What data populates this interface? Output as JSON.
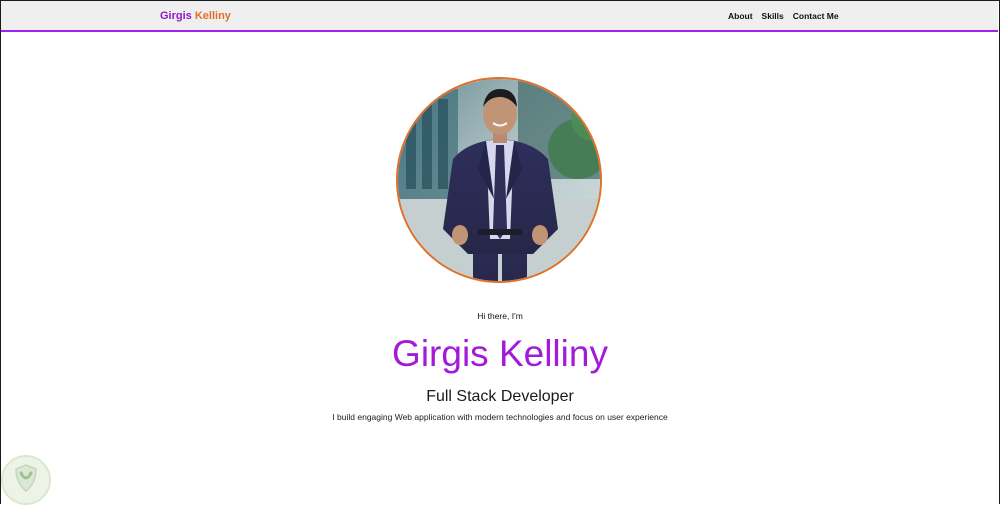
{
  "nav": {
    "brand_first": "Girgis",
    "brand_last": "Kelliny",
    "links": [
      "About",
      "Skills",
      "Contact Me"
    ]
  },
  "hero": {
    "greeting": "Hi there, I'm",
    "name": "Girgis Kelliny",
    "role": "Full Stack Developer",
    "description": "I build engaging Web application with modern technologies and focus on user experience"
  },
  "colors": {
    "accent_purple": "#a31ad9",
    "accent_orange": "#e0702a",
    "nav_border": "#a020f0"
  },
  "icons": {
    "profile_photo": "profile-photo",
    "bottom_left_badge": "shield-leaf-icon"
  }
}
